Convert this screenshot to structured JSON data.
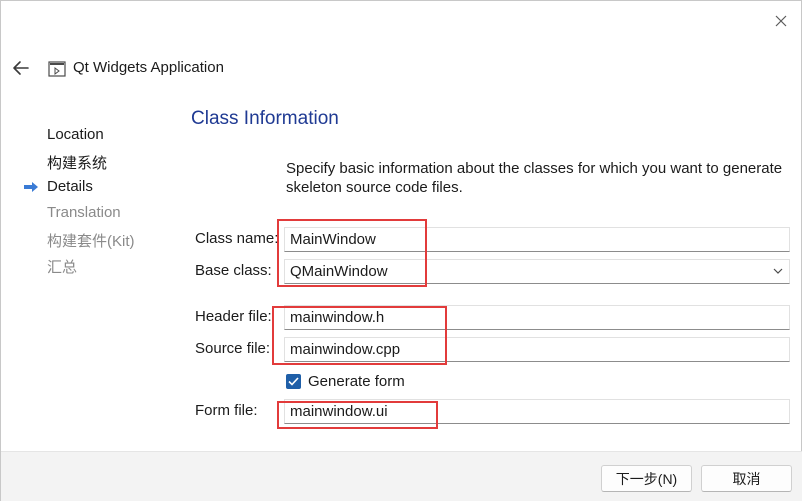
{
  "window": {
    "title": "Qt Widgets Application"
  },
  "steps": [
    {
      "label": "Location",
      "state": "done"
    },
    {
      "label": "构建系统",
      "state": "done"
    },
    {
      "label": "Details",
      "state": "current"
    },
    {
      "label": "Translation",
      "state": "pending"
    },
    {
      "label": "构建套件(Kit)",
      "state": "pending"
    },
    {
      "label": "汇总",
      "state": "pending"
    }
  ],
  "section": {
    "title": "Class Information",
    "description": "Specify basic information about the classes for which you want to generate skeleton source code files."
  },
  "fields": {
    "class_name": {
      "label": "Class name:",
      "value": "MainWindow"
    },
    "base_class": {
      "label": "Base class:",
      "value": "QMainWindow"
    },
    "header_file": {
      "label": "Header file:",
      "value": "mainwindow.h"
    },
    "source_file": {
      "label": "Source file:",
      "value": "mainwindow.cpp"
    },
    "generate_form": {
      "label": "Generate form",
      "checked": true
    },
    "form_file": {
      "label": "Form file:",
      "value": "mainwindow.ui"
    }
  },
  "buttons": {
    "next": "下一步(N)",
    "cancel": "取消"
  },
  "colors": {
    "accent": "#1f5fa8",
    "section_title": "#1f3a93",
    "highlight": "#e23b3b",
    "step_arrow": "#3a7bd5"
  },
  "icons": {
    "back": "arrow-left-icon",
    "app": "window-icon",
    "close": "close-icon",
    "current_step": "arrow-right-icon",
    "dropdown": "chevron-down-icon",
    "check": "checkmark-icon"
  }
}
